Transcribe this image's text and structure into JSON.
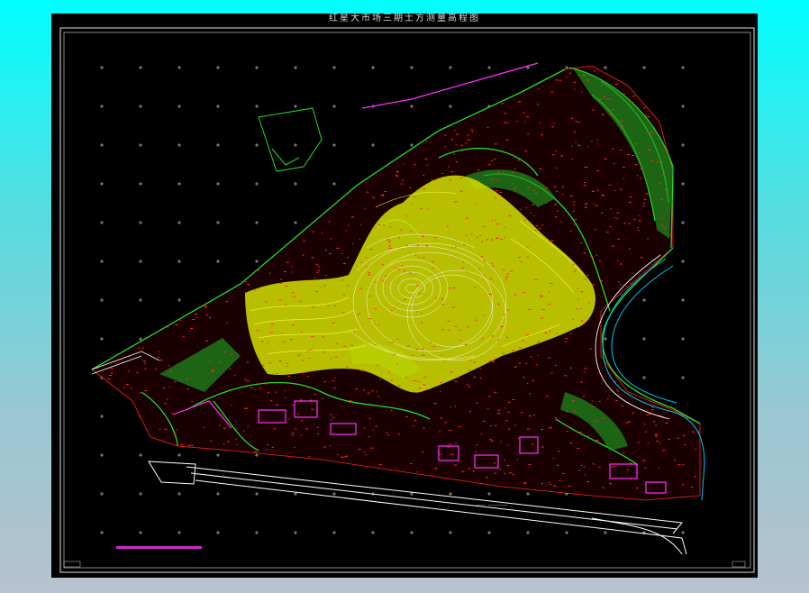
{
  "drawing": {
    "title": "红星大市场三期土方测量高程图"
  },
  "colors": {
    "background_gradient_top": "#00ffff",
    "background_gradient_bottom": "#b7c2cf",
    "sheet": "#000000",
    "contour_major": "#ffff00",
    "contour_minor": "#ffffff",
    "terrain_green": "#22dd22",
    "elevation_points": "#ff2a2a",
    "boundary": "#ff00ff",
    "road": "#ffffff",
    "water_edge": "#00c8ff"
  },
  "icons": {
    "grid_marker": "plus-cross",
    "survey_point": "red-dot"
  }
}
